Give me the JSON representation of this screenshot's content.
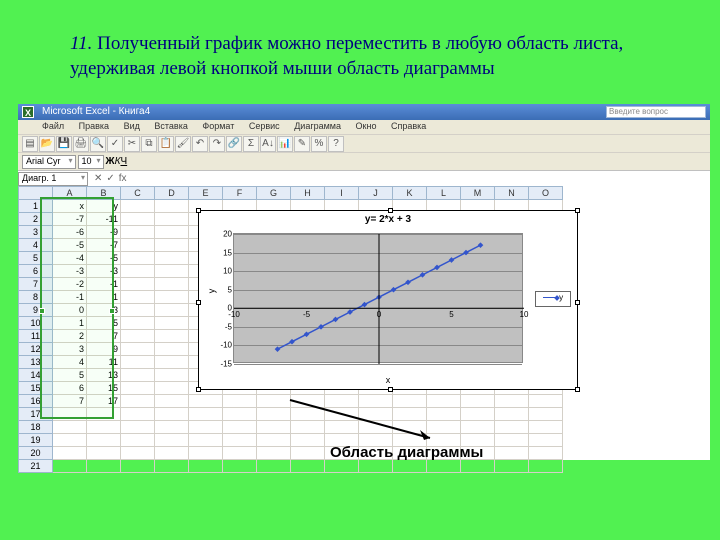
{
  "slide": {
    "title_num": "11.",
    "title_text": "Полученный график можно переместить в любую область листа, удерживая левой кнопкой мыши область диаграммы",
    "annotation": "Область диаграммы"
  },
  "excel": {
    "title": "Microsoft Excel - Книга4",
    "ask": "Введите вопрос",
    "menu": [
      "Файл",
      "Правка",
      "Вид",
      "Вставка",
      "Формат",
      "Сервис",
      "Диаграмма",
      "Окно",
      "Справка"
    ],
    "namebox": "Диагр. 1",
    "fx": "fx",
    "font_name": "Arial Cyr",
    "font_size": "10"
  },
  "icons": [
    "new",
    "open",
    "save",
    "print",
    "preview",
    "spell",
    "cut",
    "copy",
    "paste",
    "fmtpaint",
    "undo",
    "redo",
    "link",
    "sum",
    "sort",
    "chart",
    "draw",
    "zoom",
    "help"
  ],
  "cols": [
    "A",
    "B",
    "C",
    "D",
    "E",
    "F",
    "G",
    "H",
    "I",
    "J",
    "K",
    "L",
    "M",
    "N",
    "O"
  ],
  "rows_data": [
    [
      "x",
      "y"
    ],
    [
      "-7",
      "-11"
    ],
    [
      "-6",
      "-9"
    ],
    [
      "-5",
      "-7"
    ],
    [
      "-4",
      "-5"
    ],
    [
      "-3",
      "-3"
    ],
    [
      "-2",
      "-1"
    ],
    [
      "-1",
      "1"
    ],
    [
      "0",
      "3"
    ],
    [
      "1",
      "5"
    ],
    [
      "2",
      "7"
    ],
    [
      "3",
      "9"
    ],
    [
      "4",
      "11"
    ],
    [
      "5",
      "13"
    ],
    [
      "6",
      "15"
    ],
    [
      "7",
      "17"
    ]
  ],
  "empty_rows": [
    "17",
    "18",
    "19",
    "20",
    "21"
  ],
  "chart_data": {
    "type": "line",
    "title": "y= 2*x + 3",
    "xlabel": "x",
    "ylabel": "y",
    "x": [
      -7,
      -6,
      -5,
      -4,
      -3,
      -2,
      -1,
      0,
      1,
      2,
      3,
      4,
      5,
      6,
      7
    ],
    "y": [
      -11,
      -9,
      -7,
      -5,
      -3,
      -1,
      1,
      3,
      5,
      7,
      9,
      11,
      13,
      15,
      17
    ],
    "series": [
      {
        "name": "y",
        "values": [
          -11,
          -9,
          -7,
          -5,
          -3,
          -1,
          1,
          3,
          5,
          7,
          9,
          11,
          13,
          15,
          17
        ]
      }
    ],
    "xlim": [
      -10,
      10
    ],
    "ylim": [
      -15,
      20
    ],
    "yticks": [
      20,
      15,
      10,
      5,
      0,
      -5,
      -10,
      -15
    ],
    "xticks": [
      -10,
      -5,
      0,
      5,
      10
    ],
    "legend": "y"
  }
}
